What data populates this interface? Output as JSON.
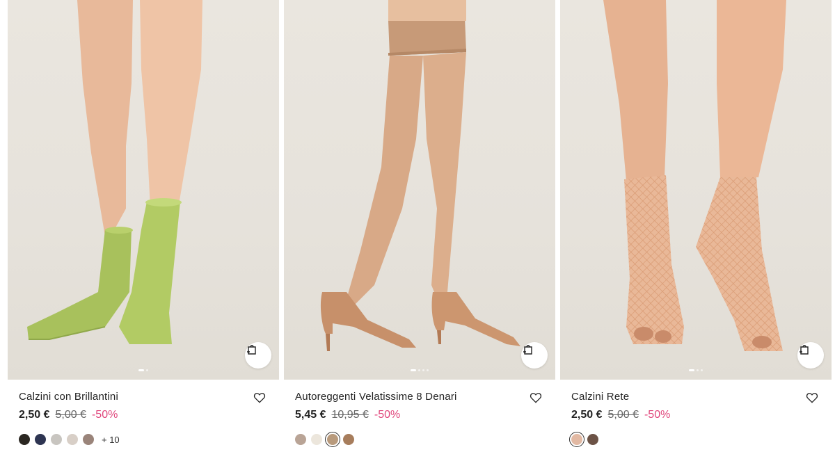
{
  "products": [
    {
      "name": "Calzini con Brillantini",
      "price": "2,50 €",
      "old_price": "5,00 €",
      "discount": "-50%",
      "swatches": [
        "#2b2722",
        "#2e3552",
        "#c8c5c0",
        "#d8cfc7",
        "#9a847a"
      ],
      "more_colors": "+ 10",
      "image_theme": "green-glitter-socks"
    },
    {
      "name": "Autoreggenti Velatissime 8 Denari",
      "price": "5,45 €",
      "old_price": "10,95 €",
      "discount": "-50%",
      "swatches": [
        "#b9a496",
        "#ece6dc",
        "#b89a7c",
        "#a77d5c"
      ],
      "selected_swatch": 2,
      "image_theme": "nude-stockings-heels"
    },
    {
      "name": "Calzini Rete",
      "price": "2,50 €",
      "old_price": "5,00 €",
      "discount": "-50%",
      "swatches": [
        "#e2b9a3",
        "#6c5346"
      ],
      "selected_swatch": 0,
      "image_theme": "fishnet-socks"
    }
  ],
  "colors": {
    "discount": "#e0457b",
    "image_bg": "#e7e3dc"
  }
}
